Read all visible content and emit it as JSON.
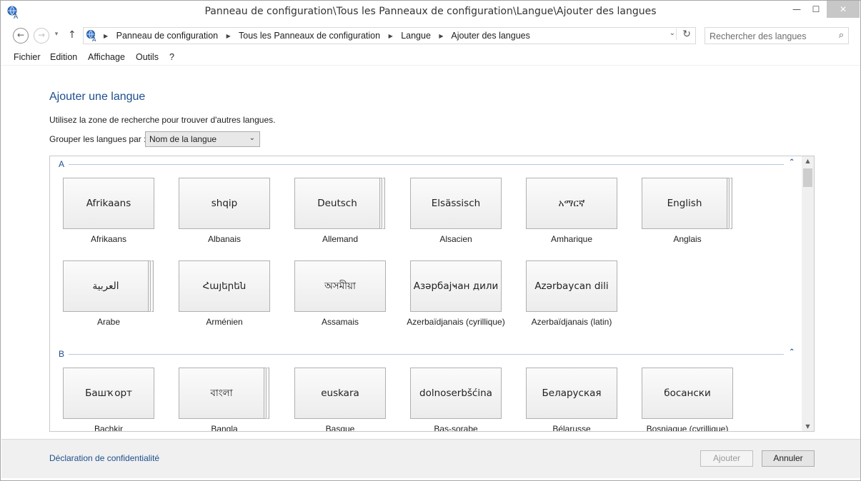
{
  "window": {
    "title": "Panneau de configuration\\Tous les Panneaux de configuration\\Langue\\Ajouter des langues",
    "controls": {
      "minimize": "—",
      "maximize": "☐",
      "close": "✕"
    }
  },
  "navigation": {
    "back_glyph": "←",
    "forward_glyph": "→",
    "recent_glyph": "▾",
    "up_glyph": "↑",
    "breadcrumbs": [
      "Panneau de configuration",
      "Tous les Panneaux de configuration",
      "Langue",
      "Ajouter des langues"
    ],
    "breadcrumb_separator": "▶",
    "dropdown_glyph": "⌄",
    "refresh_glyph": "↻",
    "search_placeholder": "Rechercher des langues",
    "search_icon": "⌕"
  },
  "menu": [
    "Fichier",
    "Edition",
    "Affichage",
    "Outils",
    "?"
  ],
  "content": {
    "heading": "Ajouter une langue",
    "hint": "Utilisez la zone de recherche pour trouver d'autres langues.",
    "group_label": "Grouper les langues par :",
    "group_value": "Nom de la langue",
    "group_chevron": "⌄"
  },
  "sections": [
    {
      "letter": "A",
      "collapse_glyph": "⌃",
      "languages": [
        {
          "native": "Afrikaans",
          "name": "Afrikaans",
          "stacked": false
        },
        {
          "native": "shqip",
          "name": "Albanais",
          "stacked": false
        },
        {
          "native": "Deutsch",
          "name": "Allemand",
          "stacked": true
        },
        {
          "native": "Elsässisch",
          "name": "Alsacien",
          "stacked": false
        },
        {
          "native": "አማርኛ",
          "name": "Amharique",
          "stacked": false
        },
        {
          "native": "English",
          "name": "Anglais",
          "stacked": true
        },
        {
          "native": "العربية",
          "name": "Arabe",
          "stacked": true
        },
        {
          "native": "Հայերեն",
          "name": "Arménien",
          "stacked": false
        },
        {
          "native": "অসমীয়া",
          "name": "Assamais",
          "stacked": false
        },
        {
          "native": "Азәрбајҹан дили",
          "name": "Azerbaïdjanais (cyrillique)",
          "stacked": false
        },
        {
          "native": "Azərbaycan dili",
          "name": "Azerbaïdjanais (latin)",
          "stacked": false
        }
      ]
    },
    {
      "letter": "B",
      "collapse_glyph": "⌃",
      "languages": [
        {
          "native": "Башҡорт",
          "name": "Bachkir",
          "stacked": false
        },
        {
          "native": "বাংলা",
          "name": "Bangla",
          "stacked": true
        },
        {
          "native": "euskara",
          "name": "Basque",
          "stacked": false
        },
        {
          "native": "dolnoserbšćina",
          "name": "Bas-sorabe",
          "stacked": false
        },
        {
          "native": "Беларуская",
          "name": "Bélarusse",
          "stacked": false
        },
        {
          "native": "босански",
          "name": "Bosniaque (cyrillique)",
          "stacked": false
        }
      ]
    }
  ],
  "scrollbar": {
    "up": "▲",
    "down": "▼"
  },
  "footer": {
    "privacy_link": "Déclaration de confidentialité",
    "add_button": "Ajouter",
    "cancel_button": "Annuler"
  }
}
